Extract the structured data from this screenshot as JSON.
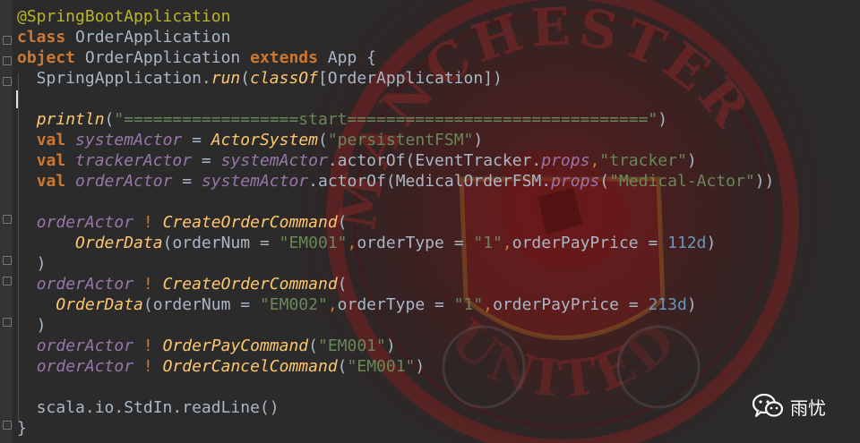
{
  "editor": {
    "lines": [
      {
        "tokens": [
          {
            "t": "@SpringBootApplication",
            "c": "ann"
          }
        ]
      },
      {
        "tokens": [
          {
            "t": "class",
            "c": "kw"
          },
          {
            "t": " OrderApplication",
            "c": "plain"
          }
        ]
      },
      {
        "tokens": [
          {
            "t": "object",
            "c": "kw"
          },
          {
            "t": " OrderApplication ",
            "c": "plain"
          },
          {
            "t": "extends",
            "c": "kw"
          },
          {
            "t": " App {",
            "c": "plain"
          }
        ]
      },
      {
        "tokens": [
          {
            "t": "  SpringApplication.",
            "c": "plain"
          },
          {
            "t": "run",
            "c": "fn"
          },
          {
            "t": "(",
            "c": "plain"
          },
          {
            "t": "classOf",
            "c": "fn"
          },
          {
            "t": "[OrderApplication])",
            "c": "plain"
          }
        ]
      },
      {
        "tokens": []
      },
      {
        "tokens": [
          {
            "t": "  ",
            "c": "plain"
          },
          {
            "t": "println",
            "c": "fn"
          },
          {
            "t": "(",
            "c": "plain"
          },
          {
            "t": "\"==================start===============================\"",
            "c": "str"
          },
          {
            "t": ")",
            "c": "plain"
          }
        ]
      },
      {
        "tokens": [
          {
            "t": "  ",
            "c": "plain"
          },
          {
            "t": "val",
            "c": "kw"
          },
          {
            "t": " ",
            "c": "plain"
          },
          {
            "t": "systemActor",
            "c": "it"
          },
          {
            "t": " = ",
            "c": "plain"
          },
          {
            "t": "ActorSystem",
            "c": "fn"
          },
          {
            "t": "(",
            "c": "plain"
          },
          {
            "t": "\"persistentFSM\"",
            "c": "str"
          },
          {
            "t": ")",
            "c": "plain"
          }
        ]
      },
      {
        "tokens": [
          {
            "t": "  ",
            "c": "plain"
          },
          {
            "t": "val",
            "c": "kw"
          },
          {
            "t": " ",
            "c": "plain"
          },
          {
            "t": "trackerActor",
            "c": "it"
          },
          {
            "t": " = ",
            "c": "plain"
          },
          {
            "t": "systemActor",
            "c": "it"
          },
          {
            "t": ".actorOf(EventTracker.",
            "c": "plain"
          },
          {
            "t": "props",
            "c": "it"
          },
          {
            "t": ",",
            "c": "sym"
          },
          {
            "t": "\"tracker\"",
            "c": "str"
          },
          {
            "t": ")",
            "c": "plain"
          }
        ]
      },
      {
        "tokens": [
          {
            "t": "  ",
            "c": "plain"
          },
          {
            "t": "val",
            "c": "kw"
          },
          {
            "t": " ",
            "c": "plain"
          },
          {
            "t": "orderActor",
            "c": "it"
          },
          {
            "t": " = ",
            "c": "plain"
          },
          {
            "t": "systemActor",
            "c": "it"
          },
          {
            "t": ".actorOf(MedicalOrderFSM.",
            "c": "plain"
          },
          {
            "t": "props",
            "c": "it"
          },
          {
            "t": "(",
            "c": "plain"
          },
          {
            "t": "\"Medical-Actor\"",
            "c": "str"
          },
          {
            "t": "))",
            "c": "plain"
          }
        ]
      },
      {
        "tokens": []
      },
      {
        "tokens": [
          {
            "t": "  ",
            "c": "plain"
          },
          {
            "t": "orderActor",
            "c": "it"
          },
          {
            "t": " ",
            "c": "plain"
          },
          {
            "t": "!",
            "c": "sym"
          },
          {
            "t": " ",
            "c": "plain"
          },
          {
            "t": "CreateOrderCommand",
            "c": "fn"
          },
          {
            "t": "(",
            "c": "plain"
          }
        ]
      },
      {
        "tokens": [
          {
            "t": "      ",
            "c": "plain"
          },
          {
            "t": "OrderData",
            "c": "fn"
          },
          {
            "t": "(orderNum = ",
            "c": "plain"
          },
          {
            "t": "\"EM001\"",
            "c": "str"
          },
          {
            "t": ",",
            "c": "sym"
          },
          {
            "t": "orderType = ",
            "c": "plain"
          },
          {
            "t": "\"1\"",
            "c": "str"
          },
          {
            "t": ",",
            "c": "sym"
          },
          {
            "t": "orderPayPrice = ",
            "c": "plain"
          },
          {
            "t": "112d",
            "c": "num"
          },
          {
            "t": ")",
            "c": "plain"
          }
        ]
      },
      {
        "tokens": [
          {
            "t": "  )",
            "c": "plain"
          }
        ]
      },
      {
        "tokens": [
          {
            "t": "  ",
            "c": "plain"
          },
          {
            "t": "orderActor",
            "c": "it"
          },
          {
            "t": " ",
            "c": "plain"
          },
          {
            "t": "!",
            "c": "sym"
          },
          {
            "t": " ",
            "c": "plain"
          },
          {
            "t": "CreateOrderCommand",
            "c": "fn"
          },
          {
            "t": "(",
            "c": "plain"
          }
        ]
      },
      {
        "tokens": [
          {
            "t": "    ",
            "c": "plain"
          },
          {
            "t": "OrderData",
            "c": "fn"
          },
          {
            "t": "(orderNum = ",
            "c": "plain"
          },
          {
            "t": "\"EM002\"",
            "c": "str"
          },
          {
            "t": ",",
            "c": "sym"
          },
          {
            "t": "orderType = ",
            "c": "plain"
          },
          {
            "t": "\"1\"",
            "c": "str"
          },
          {
            "t": ",",
            "c": "sym"
          },
          {
            "t": "orderPayPrice = ",
            "c": "plain"
          },
          {
            "t": "213d",
            "c": "num"
          },
          {
            "t": ")",
            "c": "plain"
          }
        ]
      },
      {
        "tokens": [
          {
            "t": "  )",
            "c": "plain"
          }
        ]
      },
      {
        "tokens": [
          {
            "t": "  ",
            "c": "plain"
          },
          {
            "t": "orderActor",
            "c": "it"
          },
          {
            "t": " ",
            "c": "plain"
          },
          {
            "t": "!",
            "c": "sym"
          },
          {
            "t": " ",
            "c": "plain"
          },
          {
            "t": "OrderPayCommand",
            "c": "fn"
          },
          {
            "t": "(",
            "c": "plain"
          },
          {
            "t": "\"EM001\"",
            "c": "str"
          },
          {
            "t": ")",
            "c": "plain"
          }
        ]
      },
      {
        "tokens": [
          {
            "t": "  ",
            "c": "plain"
          },
          {
            "t": "orderActor",
            "c": "it"
          },
          {
            "t": " ",
            "c": "plain"
          },
          {
            "t": "!",
            "c": "sym"
          },
          {
            "t": " ",
            "c": "plain"
          },
          {
            "t": "OrderCancelCommand",
            "c": "fn"
          },
          {
            "t": "(",
            "c": "plain"
          },
          {
            "t": "\"EM001\"",
            "c": "str"
          },
          {
            "t": ")",
            "c": "plain"
          }
        ]
      },
      {
        "tokens": []
      },
      {
        "tokens": [
          {
            "t": "  scala.io.StdIn.readLine()",
            "c": "plain"
          }
        ]
      },
      {
        "tokens": [
          {
            "t": "}",
            "c": "plain"
          }
        ]
      }
    ]
  },
  "watermark": {
    "text": "MANCHESTER",
    "bottom_text": "UNITED",
    "color": "#8b1a1a"
  },
  "brand": {
    "icon": "wechat-icon",
    "name": "雨忧"
  },
  "colors": {
    "background": "#2b2b2b",
    "keyword": "#cc7832",
    "string": "#6a8759",
    "number": "#6897bb",
    "annotation": "#bbb529",
    "function": "#ffc66d",
    "field": "#9876aa",
    "default": "#a9b7c6"
  }
}
